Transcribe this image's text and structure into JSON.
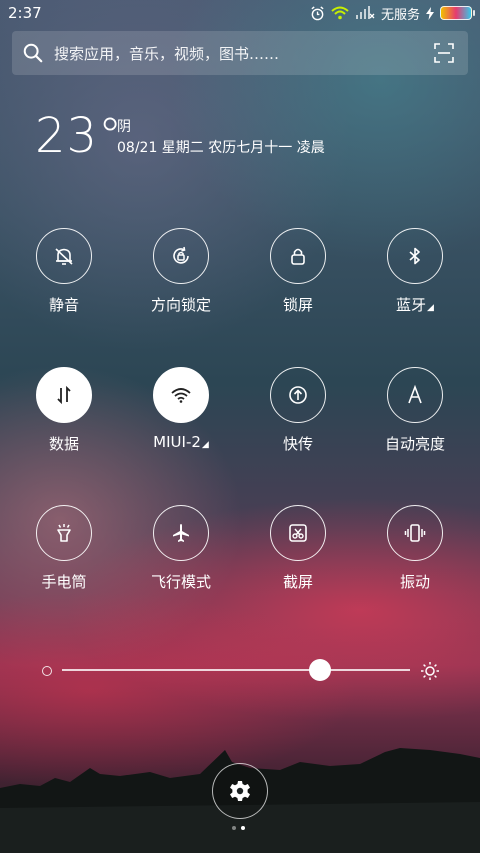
{
  "status_bar": {
    "time": "2:37",
    "carrier": "无服务"
  },
  "search": {
    "placeholder": "搜索应用，音乐，视频，图书……"
  },
  "weather": {
    "temperature": "23°",
    "condition": "阴",
    "date_line": "08/21  星期二  农历七月十一  凌晨"
  },
  "toggles": [
    {
      "label": "静音",
      "icon": "bell-off-icon",
      "active": false
    },
    {
      "label": "方向锁定",
      "icon": "rotation-lock-icon",
      "active": false
    },
    {
      "label": "锁屏",
      "icon": "lock-icon",
      "active": false
    },
    {
      "label": "蓝牙",
      "icon": "bluetooth-icon",
      "active": false,
      "has_submenu": true
    },
    {
      "label": "数据",
      "icon": "mobile-data-icon",
      "active": true
    },
    {
      "label": "MIUI-2",
      "icon": "wifi-icon",
      "active": true,
      "has_submenu": true
    },
    {
      "label": "快传",
      "icon": "share-upload-icon",
      "active": false
    },
    {
      "label": "自动亮度",
      "icon": "auto-brightness-icon",
      "active": false
    },
    {
      "label": "手电筒",
      "icon": "flashlight-icon",
      "active": false
    },
    {
      "label": "飞行模式",
      "icon": "airplane-icon",
      "active": false
    },
    {
      "label": "截屏",
      "icon": "screenshot-icon",
      "active": false
    },
    {
      "label": "振动",
      "icon": "vibrate-icon",
      "active": false
    }
  ],
  "brightness": {
    "level": 0.74
  },
  "pager": {
    "pages": 2,
    "current": 2
  }
}
